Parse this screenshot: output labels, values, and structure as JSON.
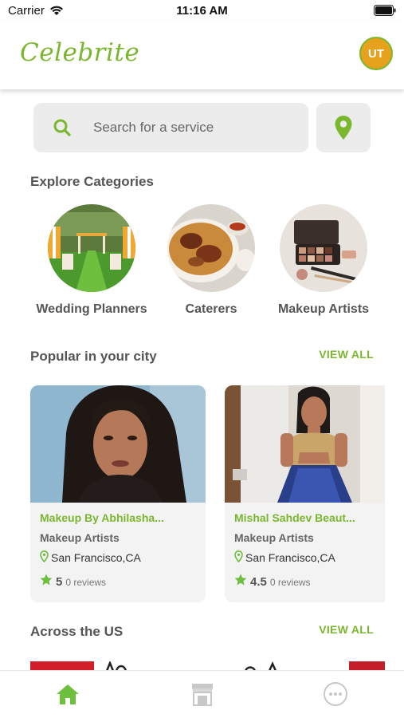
{
  "status": {
    "carrier": "Carrier",
    "time": "11:16 AM"
  },
  "header": {
    "brand": "Celebrite",
    "avatar_initials": "UT"
  },
  "search": {
    "placeholder": "Search for a service"
  },
  "explore": {
    "title": "Explore Categories",
    "categories": [
      {
        "label": "Wedding Planners"
      },
      {
        "label": "Caterers"
      },
      {
        "label": "Makeup Artists"
      }
    ]
  },
  "popular": {
    "title": "Popular in your city",
    "view_all": "VIEW ALL",
    "cards": [
      {
        "name": "Makeup By Abhilasha...",
        "category": "Makeup Artists",
        "location": "San Francisco,CA",
        "rating": "5",
        "reviews": "0 reviews"
      },
      {
        "name": "Mishal Sahdev Beaut...",
        "category": "Makeup Artists",
        "location": "San Francisco,CA",
        "rating": "4.5",
        "reviews": "0 reviews"
      }
    ]
  },
  "across": {
    "title": "Across the US",
    "view_all": "VIEW ALL"
  },
  "tabs": [
    {
      "icon": "home-icon",
      "active": true
    },
    {
      "icon": "store-icon",
      "active": false
    },
    {
      "icon": "more-icon",
      "active": false
    }
  ],
  "colors": {
    "accent": "#7ab72f",
    "avatar_bg": "#e6a21c",
    "field_bg": "#ececec",
    "card_bg": "#f3f3f3"
  }
}
